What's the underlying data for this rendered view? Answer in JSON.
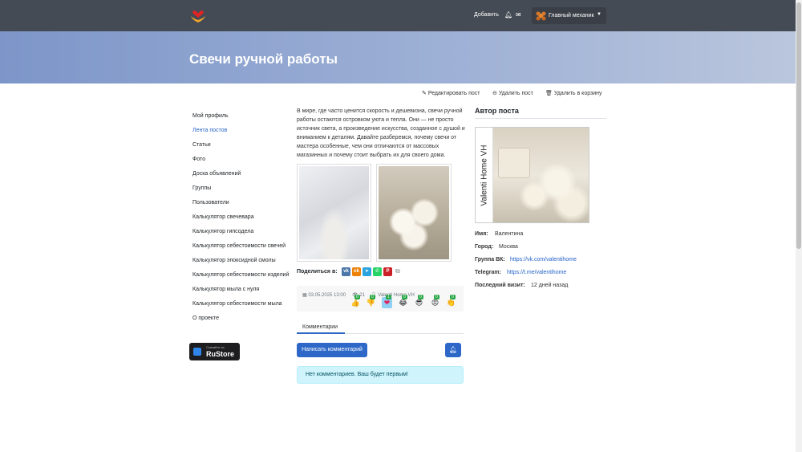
{
  "header": {
    "add_label": "Добавить",
    "user_name": "Главный механик",
    "notification_icon": "bell-icon",
    "message_icon": "envelope-icon"
  },
  "page": {
    "title": "Свечи ручной работы"
  },
  "post_actions": {
    "edit": "Редактировать пост",
    "delete": "Удалить пост",
    "trash": "Удалить в корзину"
  },
  "sidebar": {
    "items": [
      {
        "label": "Мой профиль"
      },
      {
        "label": "Лента постов"
      },
      {
        "label": "Статьи"
      },
      {
        "label": "Фото"
      },
      {
        "label": "Доска объявлений"
      },
      {
        "label": "Группы"
      },
      {
        "label": "Пользователи"
      },
      {
        "label": "Калькулятор свечевара"
      },
      {
        "label": "Калькулятор гипсодела"
      },
      {
        "label": "Калькулятор себестоимости свечей"
      },
      {
        "label": "Калькулятор эпоксидной смолы"
      },
      {
        "label": "Калькулятор себестоимости изделий"
      },
      {
        "label": "Калькулятор мыла с нуля"
      },
      {
        "label": "Калькулятор себестоимости мыла"
      },
      {
        "label": "О проекте"
      }
    ],
    "active_index": 1,
    "rustore_small": "Скачайте из",
    "rustore_label": "RuStore"
  },
  "post": {
    "text": "В мире, где часто ценится скорость и дешевизна, свечи ручной работы остаются островком уюта и тепла. Они — не просто источник света, а произведение искусства, созданное с душой и вниманием к деталям. Давайте разберемся, почему свечи от мастера особенные, чем они отличаются от массовых магазинных и почему стоит выбрать их для своего дома.",
    "share_label": "Поделиться в:",
    "share_buttons": [
      {
        "icon": "vk-icon",
        "glyph": "vk",
        "color": "#4a76a8"
      },
      {
        "icon": "odnoklassniki-icon",
        "glyph": "ok",
        "color": "#ee8208"
      },
      {
        "icon": "telegram-icon",
        "glyph": "➤",
        "color": "#2aa3df"
      },
      {
        "icon": "whatsapp-icon",
        "glyph": "✆",
        "color": "#25d366"
      },
      {
        "icon": "pinterest-icon",
        "glyph": "P",
        "color": "#cb2027"
      }
    ],
    "date": "03.05.2025 13:00",
    "views": "21",
    "author": "Valenti Home VH",
    "reactions": [
      {
        "icon": "thumbs-up-icon",
        "glyph": "👍",
        "count": "0"
      },
      {
        "icon": "thumbs-down-icon",
        "glyph": "👎",
        "count": "0"
      },
      {
        "icon": "heart-icon",
        "glyph": "❤",
        "count": "1"
      },
      {
        "icon": "laughing-icon",
        "glyph": "😂",
        "count": "0"
      },
      {
        "icon": "cool-icon",
        "glyph": "😎",
        "count": "0"
      },
      {
        "icon": "angry-icon",
        "glyph": "😡",
        "count": "0"
      },
      {
        "icon": "clap-icon",
        "glyph": "👏",
        "count": "0"
      }
    ],
    "comments_tab": "Комментарии",
    "write_comment": "Написать комментарий",
    "no_comments": "Нет комментариев. Ваш будет первым!"
  },
  "author": {
    "heading": "Автор поста",
    "photo_brand": "Valenti Home VH",
    "name_label": "Имя:",
    "name": "Валентина",
    "city_label": "Город:",
    "city": "Москва",
    "vk_label": "Группа ВК:",
    "vk": "https://vk.com/valentihome",
    "telegram_label": "Telegram:",
    "telegram": "https://t.me/valentihome",
    "last_visit_label": "Последний визит:",
    "last_visit": "12 дней назад"
  }
}
